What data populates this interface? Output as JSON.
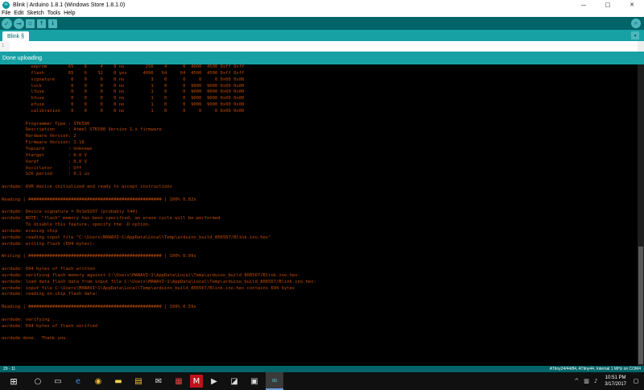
{
  "window": {
    "title": "Blink | Arduino 1.8.1 (Windows Store 1.8.1.0)",
    "controls": {
      "minimize": "—",
      "maximize": "□",
      "close": "✕"
    }
  },
  "menu": [
    "File",
    "Edit",
    "Sketch",
    "Tools",
    "Help"
  ],
  "toolbar": {
    "verify_glyph": "✓",
    "upload_glyph": "→",
    "new_glyph": "▫",
    "open_glyph": "↑",
    "save_glyph": "↓",
    "serial_glyph": "⌕"
  },
  "tab": {
    "label": "Blink §",
    "menu_glyph": "▾"
  },
  "editor": {
    "gutter_text": "1"
  },
  "status": {
    "message": "Done uploading"
  },
  "console": {
    "lines": [
      "           eeprom        65    6     4    0 no        256    4      0  4000  4500 0xff 0xff",
      "           flash         65    6    32    0 yes      4096   64     64  4500  4500 0xff 0xff",
      "           signature      0    0     0    0 no          3    0      0     0     0 0x00 0x00",
      "           lock           0    0     0    0 no          1    0      0  9000  9000 0x00 0x00",
      "           lfuse          0    0     0    0 no          1    0      0  9000  9000 0x00 0x00",
      "           hfuse          0    0     0    0 no          1    0      0  9000  9000 0x00 0x00",
      "           efuse          0    0     0    0 no          1    0      0  9000  9000 0x00 0x00",
      "           calibration    0    0     0    0 no          1    0      0     0     0 0x00 0x00",
      "",
      "         Programmer Type : STK500",
      "         Description     : Atmel STK500 Version 1.x firmware",
      "         Hardware Version: 2",
      "         Firmware Version: 1.18",
      "         Topcard         : Unknown",
      "         Vtarget         : 0.0 V",
      "         Varef           : 0.0 V",
      "         Oscillator      : Off",
      "         SCK period      : 0.1 us",
      "",
      "avrdude: AVR device initialized and ready to accept instructions",
      "",
      "Reading | ################################################## | 100% 0.02s",
      "",
      "avrdude: Device signature = 0x1e9207 (probably t44)",
      "avrdude: NOTE: \"flash\" memory has been specified, an erase cycle will be performed",
      "         To disable this feature, specify the -D option.",
      "avrdude: erasing chip",
      "avrdude: reading input file \"C:\\Users\\MANAVI~1\\AppData\\Local\\Temp\\arduino_build_806567/Blink.ino.hex\"",
      "avrdude: writing flash (694 bytes):",
      "",
      "Writing | ################################################## | 100% 0.99s",
      "",
      "avrdude: 694 bytes of flash written",
      "avrdude: verifying flash memory against C:\\Users\\MANAVI~1\\AppData\\Local\\Temp\\arduino_build_806567/Blink.ino.hex:",
      "avrdude: load data flash data from input file C:\\Users\\MANAVI~1\\AppData\\Local\\Temp\\arduino_build_806567/Blink.ino.hex:",
      "avrdude: input file C:\\Users\\MANAVI~1\\AppData\\Local\\Temp\\arduino_build_806567/Blink.ino.hex contains 694 bytes",
      "avrdude: reading on-chip flash data:",
      "",
      "Reading | ################################################## | 100% 0.59s",
      "",
      "avrdude: verifying ...",
      "avrdude: 694 bytes of flash verified",
      "",
      "avrdude done.  Thank you.",
      ""
    ]
  },
  "infobar": {
    "line_number": "29 - 11",
    "board": "ATtiny24/44/84, ATtiny44, Internal 1 MHz on COM4"
  },
  "taskbar": {
    "start_glyph": "⊞",
    "apps": [
      {
        "name": "search",
        "glyph": "○"
      },
      {
        "name": "task-view",
        "glyph": "▭"
      },
      {
        "name": "edge",
        "glyph": "e"
      },
      {
        "name": "chrome",
        "glyph": "◉"
      },
      {
        "name": "sticky-notes",
        "glyph": "▬"
      },
      {
        "name": "file-explorer",
        "glyph": "▤"
      },
      {
        "name": "mail",
        "glyph": "✉"
      },
      {
        "name": "pictures",
        "glyph": "▦"
      },
      {
        "name": "mcafee",
        "glyph": "M"
      },
      {
        "name": "media",
        "glyph": "▶"
      },
      {
        "name": "photos",
        "glyph": "◪"
      },
      {
        "name": "movies",
        "glyph": "▣"
      },
      {
        "name": "arduino",
        "glyph": "∞"
      }
    ],
    "tray": {
      "chevron": "^",
      "network": "▥",
      "volume": "♪",
      "time": "10:51 PM",
      "date": "3/17/2017",
      "notifications": "▢"
    }
  }
}
